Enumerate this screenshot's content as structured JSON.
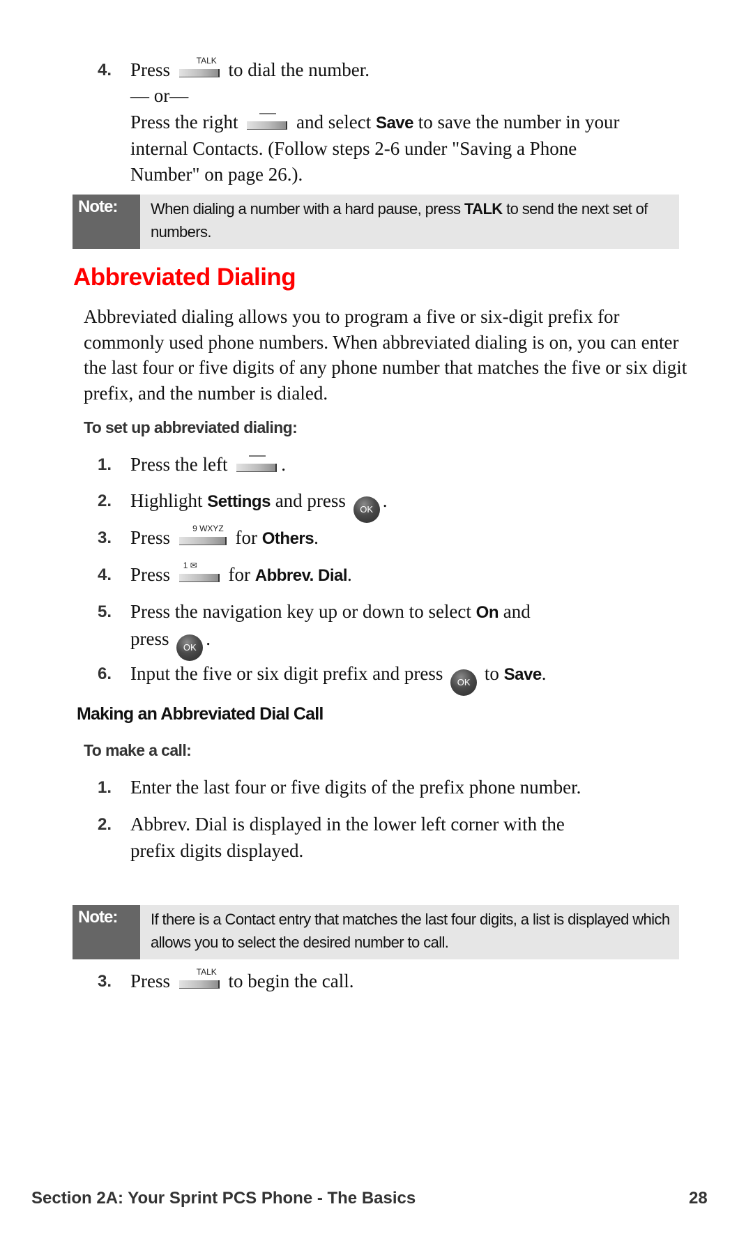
{
  "prev_step": {
    "number": "4.",
    "line1": {
      "pre": "Press",
      "key": "TALK",
      "post": "to dial the number."
    },
    "or": "— or—",
    "line2": {
      "pre": "Press the right",
      "mid": "and select",
      "keyword": "Save",
      "post": "to save the number in your"
    },
    "line3": "internal Contacts. (Follow steps 2-6 under \"Saving a Phone",
    "line4": "Number\" on page 26.)."
  },
  "note1": {
    "label": "Note:",
    "pre": "When dialing a number with a hard pause, press",
    "keyword": "TALK",
    "post": "to send the next set of numbers."
  },
  "section": {
    "title": "Abbreviated Dialing",
    "paragraph": "Abbreviated dialing allows you to program a five or six-digit prefix for commonly used phone numbers. When abbreviated dialing is on, you can enter the last four or five digits of any phone number that matches the five or six digit prefix, and the number is dialed.",
    "setup_heading": "To set up abbreviated dialing:",
    "setup_steps": [
      {
        "number": "1.",
        "pre": "Press the left",
        "post": "."
      },
      {
        "number": "2.",
        "pre": "Highlight",
        "keyword": "Settings",
        "mid": "and press",
        "button": "OK",
        "post": "."
      },
      {
        "number": "3.",
        "pre": "Press",
        "key": "9 WXYZ",
        "mid": "for",
        "keyword": "Others",
        "post": "."
      },
      {
        "number": "4.",
        "pre": "Press",
        "key": "1 ✉",
        "mid": "for",
        "keyword": "Abbrev. Dial",
        "post": "."
      },
      {
        "number": "5.",
        "pre": "Press the navigation key up or down to select",
        "keyword": "On",
        "mid": "and",
        "line2_pre": "press",
        "button": "OK",
        "post": "."
      },
      {
        "number": "6.",
        "pre": "Input the five or six digit prefix and press",
        "button": "OK",
        "mid": "to",
        "keyword": "Save",
        "post": "."
      }
    ]
  },
  "subsection": {
    "title": "Making an Abbreviated Dial Call",
    "call_heading": "To make a call:",
    "call_steps": [
      {
        "number": "1.",
        "text": "Enter the last four or five digits of the prefix phone number."
      },
      {
        "number": "2.",
        "line1": "Abbrev. Dial is displayed in the lower left corner with the",
        "line2": "prefix digits displayed."
      },
      {
        "number": "3.",
        "pre": "Press",
        "key": "TALK",
        "post": "to begin the call."
      }
    ]
  },
  "note2": {
    "label": "Note:",
    "text": "If there is a Contact entry that matches the last four digits, a list is displayed which allows you to select the desired number to call."
  },
  "footer": {
    "section": "Section 2A: Your Sprint PCS Phone - The Basics",
    "page": "28"
  },
  "colors": {
    "heading": "#ff0000",
    "note_label_bg": "#666666",
    "note_bg": "#e6e6e6"
  }
}
